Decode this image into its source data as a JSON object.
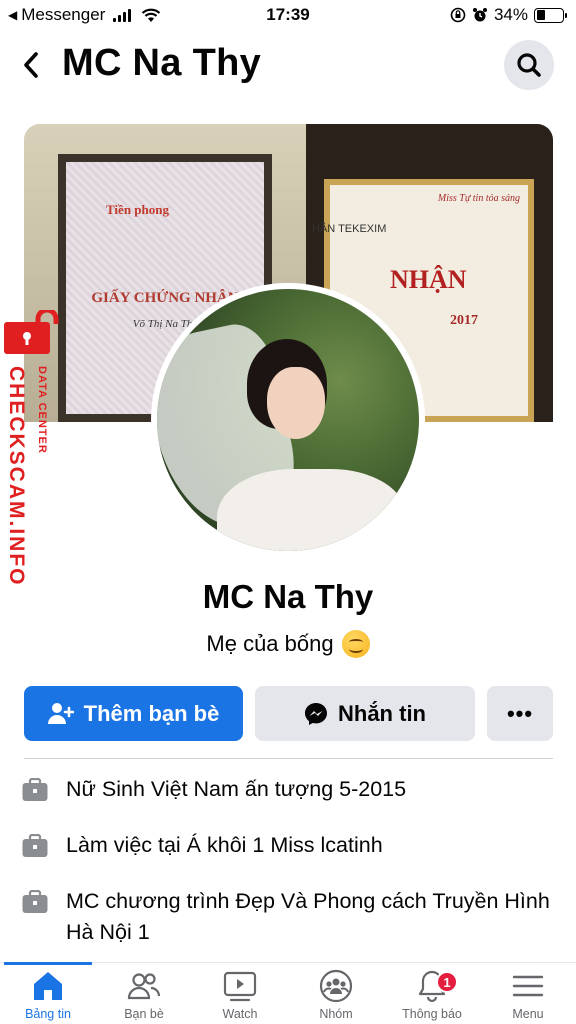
{
  "status_bar": {
    "back_app": "Messenger",
    "time": "17:39",
    "battery_percent": "34%",
    "battery_level": 0.34
  },
  "header": {
    "title": "MC Na Thy"
  },
  "cover": {
    "left_certificate": {
      "brand": "Tiền phong",
      "title": "GIẤY CHỨNG NHẬN",
      "name": "Võ Thị Na Thy"
    },
    "right_certificate": {
      "line1": "HẦN TEKEXIM",
      "line2": "NHẬN",
      "line3": "2017",
      "brand": "Miss Tự tin tỏa sáng"
    }
  },
  "watermark": {
    "main": "CHECKSCAM.INFO",
    "sub": "DATA CENTER"
  },
  "profile": {
    "name": "MC Na Thy",
    "bio": "Mẹ của bống"
  },
  "actions": {
    "add_friend": "Thêm bạn bè",
    "message": "Nhắn tin",
    "more": "•••"
  },
  "info_items": [
    {
      "icon": "briefcase-icon",
      "text": "Nữ Sinh Việt Nam ấn tượng 5-2015"
    },
    {
      "icon": "briefcase-icon",
      "text": "Làm việc tại Á khôi 1 Miss lcatinh"
    },
    {
      "icon": "briefcase-icon",
      "text": "MC chương trình Đẹp Và Phong cách Truyền Hình Hà Nội 1"
    }
  ],
  "bottom_nav": {
    "items": [
      {
        "label": "Bảng tin",
        "icon": "home-icon"
      },
      {
        "label": "Bạn bè",
        "icon": "friends-icon"
      },
      {
        "label": "Watch",
        "icon": "watch-icon"
      },
      {
        "label": "Nhóm",
        "icon": "groups-icon"
      },
      {
        "label": "Thông báo",
        "icon": "bell-icon",
        "badge": "1"
      },
      {
        "label": "Menu",
        "icon": "menu-icon"
      }
    ]
  },
  "colors": {
    "accent": "#1b74e4",
    "button_gray": "#e4e6eb",
    "badge": "#e41e3f",
    "watermark": "#e02020"
  }
}
